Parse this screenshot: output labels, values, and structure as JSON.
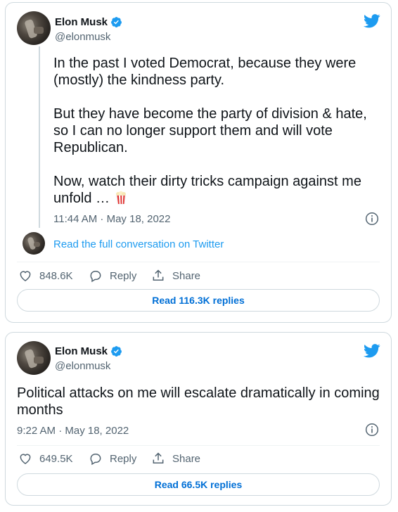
{
  "colors": {
    "accent": "#1d9bf0",
    "link": "#006fd6",
    "muted": "#536471",
    "border": "#cfd9de"
  },
  "tweets": [
    {
      "author_name": "Elon Musk",
      "author_handle": "@elonmusk",
      "text_lines": [
        "In the past I voted Democrat, because they were",
        "(mostly) the kindness party.",
        "",
        "But they have become the party of division & hate,",
        "so I can no longer support them and will vote",
        "Republican.",
        "",
        "Now, watch their dirty tricks campaign against me",
        "unfold …"
      ],
      "emoji": "popcorn",
      "timestamp": "11:44 AM · May 18, 2022",
      "read_full_link": "Read the full conversation on Twitter",
      "likes": "848.6K",
      "reply_label": "Reply",
      "share_label": "Share",
      "read_replies": "Read 116.3K replies"
    },
    {
      "author_name": "Elon Musk",
      "author_handle": "@elonmusk",
      "text_lines": [
        "Political attacks on me will escalate dramatically in coming",
        "months"
      ],
      "timestamp": "9:22 AM · May 18, 2022",
      "likes": "649.5K",
      "reply_label": "Reply",
      "share_label": "Share",
      "read_replies": "Read 66.5K replies"
    }
  ]
}
